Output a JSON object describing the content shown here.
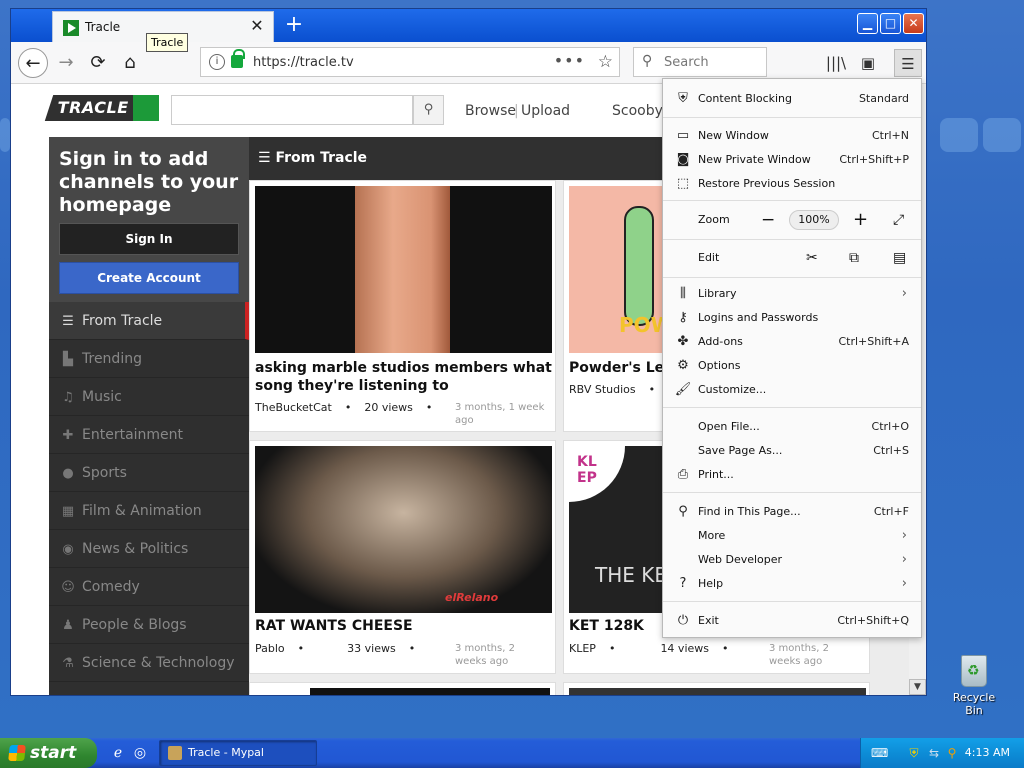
{
  "browser": {
    "tab_title": "Tracle",
    "tooltip": "Tracle",
    "url": "https://tracle.tv",
    "search_placeholder": "Search"
  },
  "site": {
    "logo_text": "TRACLE",
    "nav": [
      "Browse",
      "Upload",
      "Scooby V"
    ],
    "sign_in_heading": "Sign in to add channels to your homepage",
    "sign_in_button": "Sign In",
    "create_account_button": "Create Account",
    "section_title": "From Tracle",
    "categories": [
      {
        "label": "From Tracle",
        "icon": "list-icon"
      },
      {
        "label": "Trending",
        "icon": "chart-icon"
      },
      {
        "label": "Music",
        "icon": "headphones-icon"
      },
      {
        "label": "Entertainment",
        "icon": "gamepad-icon"
      },
      {
        "label": "Sports",
        "icon": "football-icon"
      },
      {
        "label": "Film & Animation",
        "icon": "film-icon"
      },
      {
        "label": "News & Politics",
        "icon": "broadcast-icon"
      },
      {
        "label": "Comedy",
        "icon": "masks-icon"
      },
      {
        "label": "People & Blogs",
        "icon": "people-icon"
      },
      {
        "label": "Science & Technology",
        "icon": "flask-icon"
      }
    ],
    "videos": [
      {
        "title": "asking marble studios members what song they're listening to",
        "channel": "TheBucketCat",
        "views": "20 views",
        "age": "3 months, 1 week ago"
      },
      {
        "title": "Powder's Lee",
        "channel": "RBV Studios",
        "views": "",
        "age": ""
      },
      {
        "title": "RAT WANTS CHEESE",
        "channel": "Pablo",
        "views": "33 views",
        "age": "3 months, 2 weeks ago"
      },
      {
        "title": "KET 128K",
        "channel": "KLEP",
        "views": "14 views",
        "age": "3 months, 2 weeks ago"
      }
    ],
    "thumb_texts": {
      "powder": "POW",
      "klep": "KL EP",
      "ket": "THE KE",
      "watermark": "elRelano"
    }
  },
  "menu": {
    "content_blocking": {
      "label": "Content Blocking",
      "value": "Standard"
    },
    "new_window": {
      "label": "New Window",
      "shortcut": "Ctrl+N"
    },
    "new_private_window": {
      "label": "New Private Window",
      "shortcut": "Ctrl+Shift+P"
    },
    "restore_session": {
      "label": "Restore Previous Session"
    },
    "zoom": {
      "label": "Zoom",
      "value": "100%"
    },
    "edit": {
      "label": "Edit"
    },
    "library": {
      "label": "Library"
    },
    "logins": {
      "label": "Logins and Passwords"
    },
    "addons": {
      "label": "Add-ons",
      "shortcut": "Ctrl+Shift+A"
    },
    "options": {
      "label": "Options"
    },
    "customize": {
      "label": "Customize..."
    },
    "open_file": {
      "label": "Open File...",
      "shortcut": "Ctrl+O"
    },
    "save_page": {
      "label": "Save Page As...",
      "shortcut": "Ctrl+S"
    },
    "print": {
      "label": "Print..."
    },
    "find": {
      "label": "Find in This Page...",
      "shortcut": "Ctrl+F"
    },
    "more": {
      "label": "More"
    },
    "web_developer": {
      "label": "Web Developer"
    },
    "help": {
      "label": "Help"
    },
    "exit": {
      "label": "Exit",
      "shortcut": "Ctrl+Shift+Q"
    }
  },
  "desktop": {
    "recycle_bin": "Recycle Bin"
  },
  "taskbar": {
    "start": "start",
    "task_item": "Tracle - Mypal",
    "clock": "4:13 AM"
  },
  "colors": {
    "brand_green": "#1c9a39",
    "create_blue": "#3a67c9",
    "active_red": "#cc2222"
  }
}
